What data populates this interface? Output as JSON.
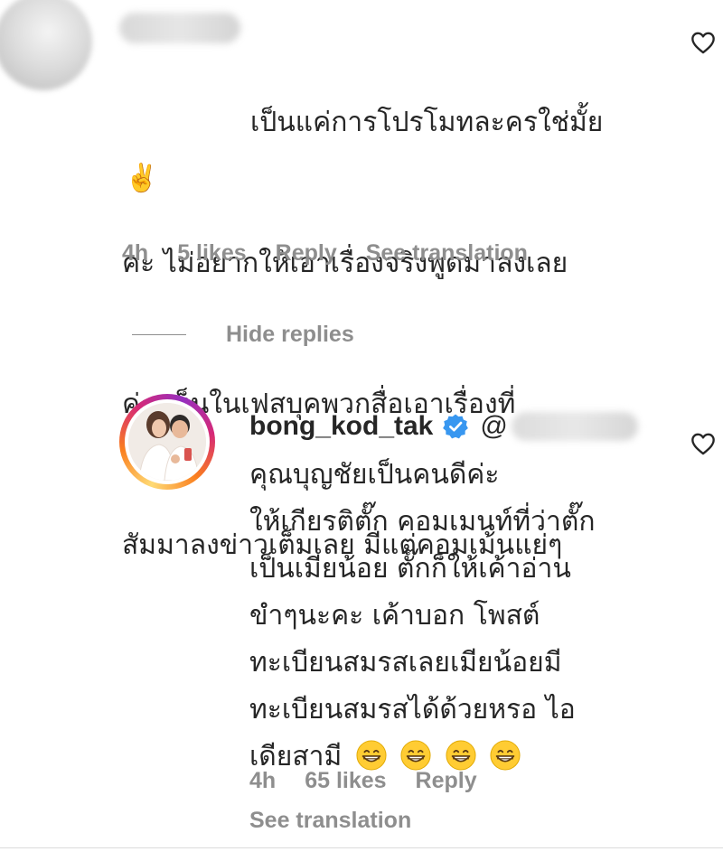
{
  "top_comment": {
    "text_lines": [
      "เป็นแค่การโปรโมทละครใช่มั้ย",
      "คะ ไม่อยากให้เอาเรื่องจริงพูดมาลงเลย",
      "ค่ะ เห็นในเฟสบุคพวกสื่อเอาเรื่องที่",
      "สัมมาลงข่าวเต็มเลย มีแต่คอมเม้นแย่ๆ"
    ],
    "emoji": "✌️",
    "time": "4h",
    "likes": "5 likes",
    "reply_label": "Reply",
    "translate_label": "See translation"
  },
  "hide_replies_label": "Hide replies",
  "reply": {
    "username": "bong_kod_tak",
    "mention_prefix": "@",
    "text_lines": [
      "คุณบุญชัยเป็นคนดีค่ะ",
      "ให้เกียรติตั๊ก คอมเมนท์ที่ว่าตั๊ก",
      "เป็นเมียน้อย ตั๊กก็ให้เค้าอ่าน",
      "ขำๆนะคะ เค้าบอก โพสต์",
      "ทะเบียนสมรสเลยเมียน้อยมี",
      "ทะเบียนสมรสได้ด้วยหรอ ไอ",
      "เดียสามี"
    ],
    "time": "4h",
    "likes": "65 likes",
    "reply_label": "Reply",
    "translate_label": "See translation"
  },
  "icons": {
    "like": "heart-outline-icon",
    "verified": "verified-badge-icon",
    "reaction": "grinning-face-icon"
  },
  "colors": {
    "text": "#262626",
    "muted": "#8e8e8e",
    "verified_blue": "#3897f0"
  }
}
